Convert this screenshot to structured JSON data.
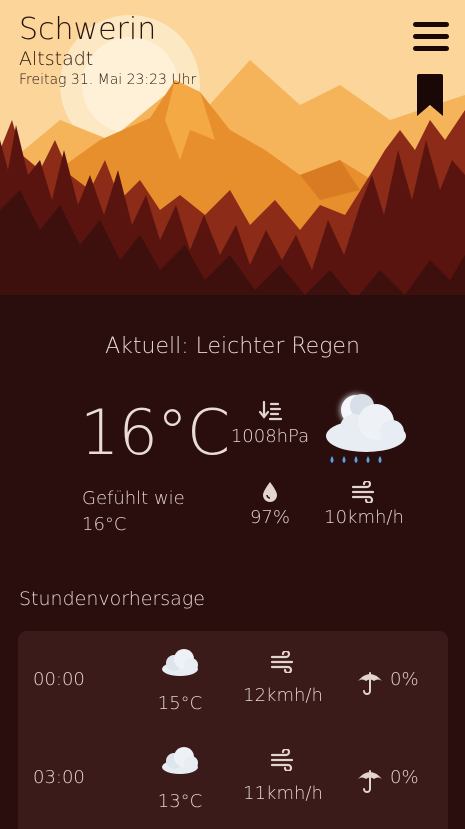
{
  "location": {
    "city": "Schwerin",
    "district": "Altstadt",
    "datetime": "Freitag 31. Mai 23:23 Uhr"
  },
  "current": {
    "condition_label": "Aktuell: Leichter Regen",
    "temperature": "16°C",
    "feels_like_label": "Gefühlt wie",
    "feels_like_value": "16°C",
    "pressure": "1008hPa",
    "humidity": "97%",
    "wind": "10kmh/h",
    "icon": "cloud-moon-rain-icon"
  },
  "hourly": {
    "title": "Stundenvorhersage",
    "rows": [
      {
        "time": "00:00",
        "temp": "15°C",
        "wind": "12kmh/h",
        "rain": "0%"
      },
      {
        "time": "03:00",
        "temp": "13°C",
        "wind": "11kmh/h",
        "rain": "0%"
      }
    ]
  },
  "colors": {
    "background": "#2a0e0e",
    "card": "#3b1a1a",
    "sky": "#fbd59a",
    "mountain": "#e78f2c",
    "forest": "#6e1a14"
  },
  "icons": [
    "menu-icon",
    "bookmark-icon",
    "pressure-icon",
    "humidity-icon",
    "wind-icon",
    "cloud-icon",
    "umbrella-icon"
  ]
}
